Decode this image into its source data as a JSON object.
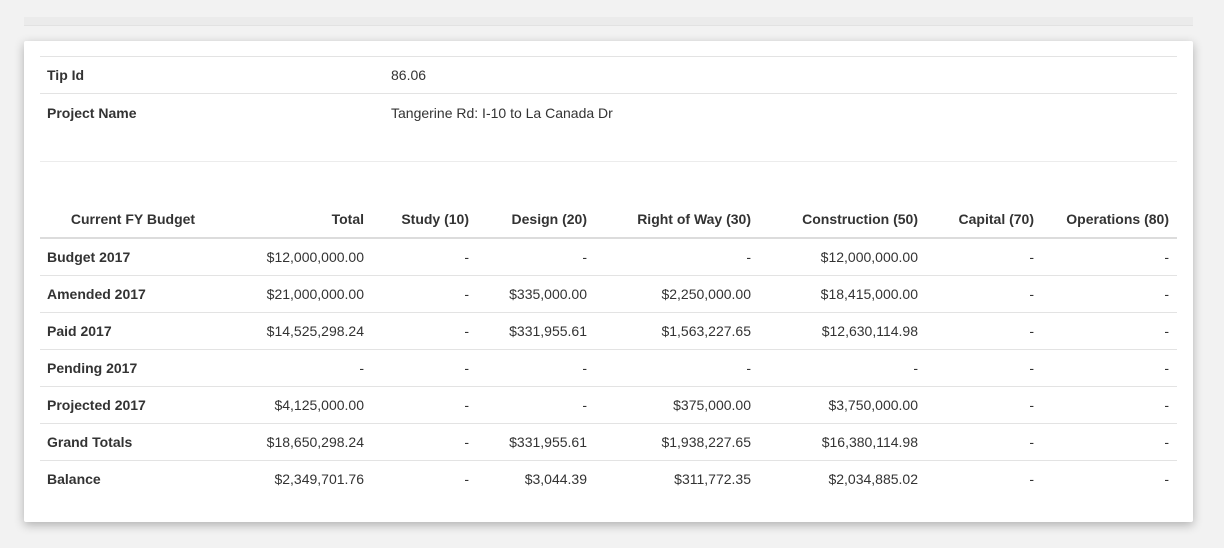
{
  "info": {
    "tip_id_label": "Tip Id",
    "tip_id_value": "86.06",
    "project_name_label": "Project Name",
    "project_name_value": "Tangerine Rd: I-10 to La Canada Dr"
  },
  "budget": {
    "headers": [
      "Current FY Budget",
      "Total",
      "Study (10)",
      "Design (20)",
      "Right of Way (30)",
      "Construction (50)",
      "Capital (70)",
      "Operations (80)"
    ],
    "rows": [
      {
        "label": "Budget 2017",
        "cells": [
          "$12,000,000.00",
          "-",
          "-",
          "-",
          "$12,000,000.00",
          "-",
          "-"
        ]
      },
      {
        "label": "Amended 2017",
        "cells": [
          "$21,000,000.00",
          "-",
          "$335,000.00",
          "$2,250,000.00",
          "$18,415,000.00",
          "-",
          "-"
        ]
      },
      {
        "label": "Paid 2017",
        "cells": [
          "$14,525,298.24",
          "-",
          "$331,955.61",
          "$1,563,227.65",
          "$12,630,114.98",
          "-",
          "-"
        ]
      },
      {
        "label": "Pending 2017",
        "cells": [
          "-",
          "-",
          "-",
          "-",
          "-",
          "-",
          "-"
        ]
      },
      {
        "label": "Projected 2017",
        "cells": [
          "$4,125,000.00",
          "-",
          "-",
          "$375,000.00",
          "$3,750,000.00",
          "-",
          "-"
        ]
      },
      {
        "label": "Grand Totals",
        "cells": [
          "$18,650,298.24",
          "-",
          "$331,955.61",
          "$1,938,227.65",
          "$16,380,114.98",
          "-",
          "-"
        ]
      },
      {
        "label": "Balance",
        "cells": [
          "$2,349,701.76",
          "-",
          "$3,044.39",
          "$311,772.35",
          "$2,034,885.02",
          "-",
          "-"
        ]
      }
    ]
  }
}
